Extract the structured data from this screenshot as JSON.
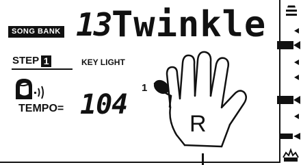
{
  "song_bank": {
    "label": "SONG BANK",
    "number": "13",
    "name": "Twinkle"
  },
  "step": {
    "label": "STEP",
    "number": "1"
  },
  "key_light": {
    "label": "KEY LIGHT"
  },
  "tempo": {
    "label": "TEMPO=",
    "value": "104"
  },
  "hand": {
    "side": "R",
    "finger_number": "1"
  },
  "icons": {
    "voice": "voice-guide-icon",
    "hand": "right-hand-icon",
    "sidebar_top": "stacked-lines-icon",
    "sidebar_bottom": "starburst-icon"
  },
  "colors": {
    "segment": "#111111",
    "background": "#ffffff"
  }
}
